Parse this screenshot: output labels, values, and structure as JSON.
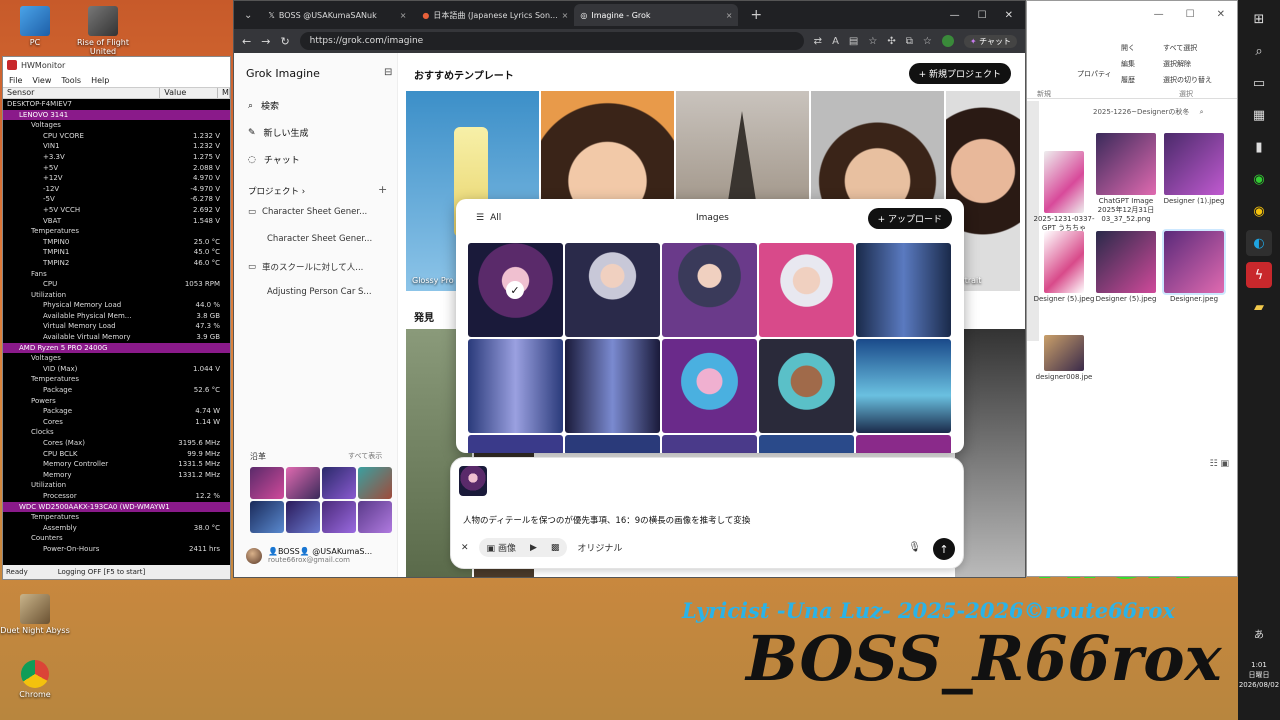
{
  "desktop": {
    "icons": [
      {
        "label": "PC"
      },
      {
        "label": "Rise of Flight United"
      },
      {
        "label": "Duet Night Abyss"
      },
      {
        "label": "Chrome"
      }
    ],
    "kick": "KICK",
    "lyricist": "Lyricist -Una Luz- 2025-2026©route66rox",
    "boss": "BOSS_R66rox"
  },
  "taskbar": {
    "time": "1:01",
    "weekday": "日曜日",
    "date": "2026/08/02",
    "ime": "あ"
  },
  "hwmonitor": {
    "title": "HWMonitor",
    "menu": [
      "File",
      "View",
      "Tools",
      "Help"
    ],
    "columns": [
      "Sensor",
      "Value",
      "M"
    ],
    "rows": [
      {
        "l": "DESKTOP-F4MIEV7",
        "v": "",
        "d": 0
      },
      {
        "l": "LENOVO 3141",
        "v": "",
        "d": 1,
        "hl": true
      },
      {
        "l": "Voltages",
        "v": "",
        "d": 2
      },
      {
        "l": "CPU VCORE",
        "v": "1.232 V",
        "d": 3
      },
      {
        "l": "VIN1",
        "v": "1.232 V",
        "d": 3
      },
      {
        "l": "+3.3V",
        "v": "1.275 V",
        "d": 3
      },
      {
        "l": "+5V",
        "v": "2.088 V",
        "d": 3
      },
      {
        "l": "+12V",
        "v": "4.970 V",
        "d": 3
      },
      {
        "l": "-12V",
        "v": "-4.970 V",
        "d": 3
      },
      {
        "l": "-5V",
        "v": "-6.278 V",
        "d": 3
      },
      {
        "l": "+5V VCCH",
        "v": "2.692 V",
        "d": 3
      },
      {
        "l": "VBAT",
        "v": "1.548 V",
        "d": 3
      },
      {
        "l": "Temperatures",
        "v": "",
        "d": 2
      },
      {
        "l": "TMPIN0",
        "v": "25.0 °C",
        "d": 3
      },
      {
        "l": "TMPIN1",
        "v": "45.0 °C",
        "d": 3
      },
      {
        "l": "TMPIN2",
        "v": "46.0 °C",
        "d": 3
      },
      {
        "l": "Fans",
        "v": "",
        "d": 2
      },
      {
        "l": "CPU",
        "v": "1053 RPM",
        "d": 3
      },
      {
        "l": "Utilization",
        "v": "",
        "d": 2
      },
      {
        "l": "Physical Memory Load",
        "v": "44.0 %",
        "d": 3
      },
      {
        "l": "Available Physical Mem...",
        "v": "3.8 GB",
        "d": 3
      },
      {
        "l": "Virtual Memory Load",
        "v": "47.3 %",
        "d": 3
      },
      {
        "l": "Available Virtual Memory",
        "v": "3.9 GB",
        "d": 3
      },
      {
        "l": "AMD Ryzen 5 PRO 2400G",
        "v": "",
        "d": 1,
        "hl": true
      },
      {
        "l": "Voltages",
        "v": "",
        "d": 2
      },
      {
        "l": "VID (Max)",
        "v": "1.044 V",
        "d": 3
      },
      {
        "l": "Temperatures",
        "v": "",
        "d": 2
      },
      {
        "l": "Package",
        "v": "52.6 °C",
        "d": 3
      },
      {
        "l": "Powers",
        "v": "",
        "d": 2
      },
      {
        "l": "Package",
        "v": "4.74 W",
        "d": 3
      },
      {
        "l": "Cores",
        "v": "1.14 W",
        "d": 3
      },
      {
        "l": "Clocks",
        "v": "",
        "d": 2
      },
      {
        "l": "Cores (Max)",
        "v": "3195.6 MHz",
        "d": 3
      },
      {
        "l": "CPU BCLK",
        "v": "99.9 MHz",
        "d": 3
      },
      {
        "l": "Memory Controller",
        "v": "1331.5 MHz",
        "d": 3
      },
      {
        "l": "Memory",
        "v": "1331.2 MHz",
        "d": 3
      },
      {
        "l": "Utilization",
        "v": "",
        "d": 2
      },
      {
        "l": "Processor",
        "v": "12.2 %",
        "d": 3
      },
      {
        "l": "WDC WD2500AAKX-193CA0 (WD-WMAYW1566729)",
        "v": "",
        "d": 1,
        "hl": true
      },
      {
        "l": "Temperatures",
        "v": "",
        "d": 2
      },
      {
        "l": "Assembly",
        "v": "38.0 °C",
        "d": 3
      },
      {
        "l": "Counters",
        "v": "",
        "d": 2
      },
      {
        "l": "Power-On-Hours",
        "v": "2411 hrs",
        "d": 3
      }
    ],
    "status_ready": "Ready",
    "status_logging": "Logging OFF [F5 to start]"
  },
  "browser": {
    "tabs": [
      {
        "label": "BOSS @USAKumaSANuk"
      },
      {
        "label": "日本語曲 (Japanese Lyrics Son..."
      },
      {
        "label": "Imagine - Grok"
      }
    ],
    "url": "https://grok.com/imagine",
    "chat_label": "チャット"
  },
  "grok": {
    "logo": "Grok Imagine",
    "nav": [
      {
        "label": "検索",
        "icon": "search-icon"
      },
      {
        "label": "新しい生成",
        "icon": "edit-icon"
      },
      {
        "label": "チャット",
        "icon": "chat-icon"
      }
    ],
    "projects_label": "プロジェクト ›",
    "projects": [
      "Character Sheet Gener...",
      "Character Sheet Gener...",
      "車のスクールに対して人...",
      "Adjusting Person Car S..."
    ],
    "history_label": "沿革",
    "see_all": "すべて表示",
    "user_name": "👤BOSS👤 @USAKumaS...",
    "user_email": "route66rox@gmail.com",
    "templates_title": "おすすめテンプレート",
    "new_project": "新規プロジェクト",
    "templates": [
      {
        "label": "Glossy Pro"
      },
      {
        "label": ""
      },
      {
        "label": ""
      },
      {
        "label": ""
      },
      {
        "label": "Portrait"
      }
    ],
    "discover_title": "発見",
    "dialog": {
      "filter": "All",
      "title": "Images",
      "upload": "アップロード"
    },
    "prompt": {
      "text": "人物のディテールを保つのが優先事項、16：9の横長の画像を推考して変換",
      "mode_image": "画像",
      "original": "オリジナル"
    }
  },
  "explorer": {
    "ribbon": [
      "開く",
      "編集",
      "履歴",
      "すべて選択",
      "選択解除",
      "選択の切り替え",
      "プロパティ",
      "新規",
      "選択"
    ],
    "path": "2025-1226~Designerの秋冬",
    "files": [
      {
        "label": "2025-1231-0337-GPT うちちゃ 3.PNG"
      },
      {
        "label": "ChatGPT Image 2025年12月31日 03_37_52.png"
      },
      {
        "label": "Designer (1).jpeg"
      },
      {
        "label": "Designer (5).jpeg"
      },
      {
        "label": "Designer (5).jpeg"
      },
      {
        "label": "Designer.jpeg"
      },
      {
        "label": "designer008.jpe"
      }
    ]
  }
}
